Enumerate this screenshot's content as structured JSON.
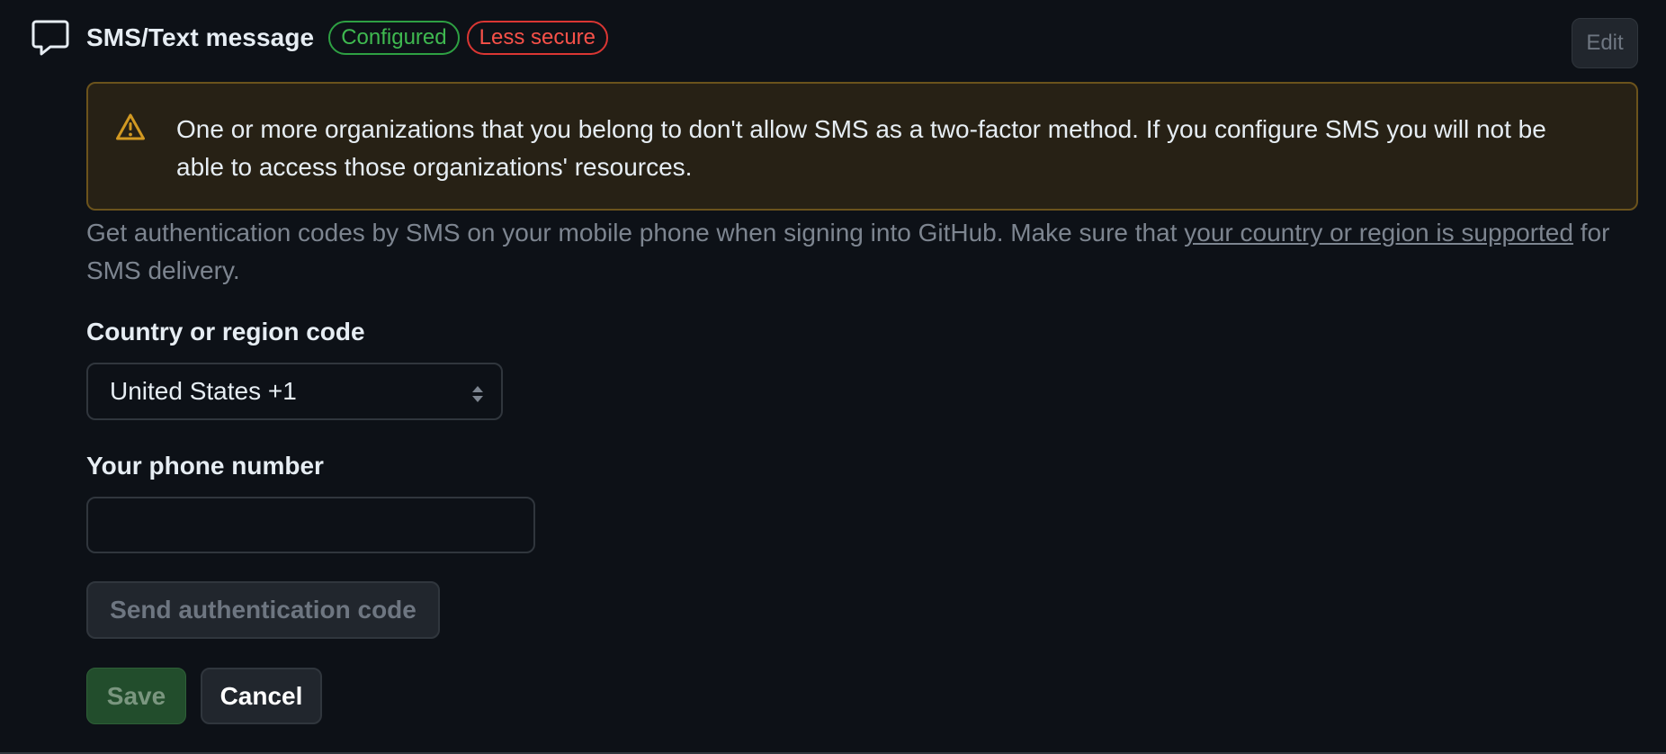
{
  "header": {
    "icon": "comment-icon",
    "title": "SMS/Text message",
    "badges": [
      {
        "label": "Configured",
        "color": "#3fb950"
      },
      {
        "label": "Less secure",
        "color": "#f85149"
      }
    ],
    "edit_label": "Edit"
  },
  "warning": {
    "icon": "alert-icon",
    "text": "One or more organizations that you belong to don't allow SMS as a two-factor method. If you configure SMS you will not be able to access those organizations' resources."
  },
  "description": {
    "before": "Get authentication codes by SMS on your mobile phone when signing into GitHub. Make sure that ",
    "link": "your country or region is supported",
    "after": " for SMS delivery."
  },
  "form": {
    "country_label": "Country or region code",
    "country_value": "United States +1",
    "phone_label": "Your phone number",
    "phone_value": "",
    "send_label": "Send authentication code",
    "save_label": "Save",
    "cancel_label": "Cancel"
  },
  "colors": {
    "background": "#0d1117",
    "warning_bg": "#272115",
    "warning_border": "#6b531c",
    "warning_icon": "#d29922",
    "save_bg": "#224d2c"
  }
}
